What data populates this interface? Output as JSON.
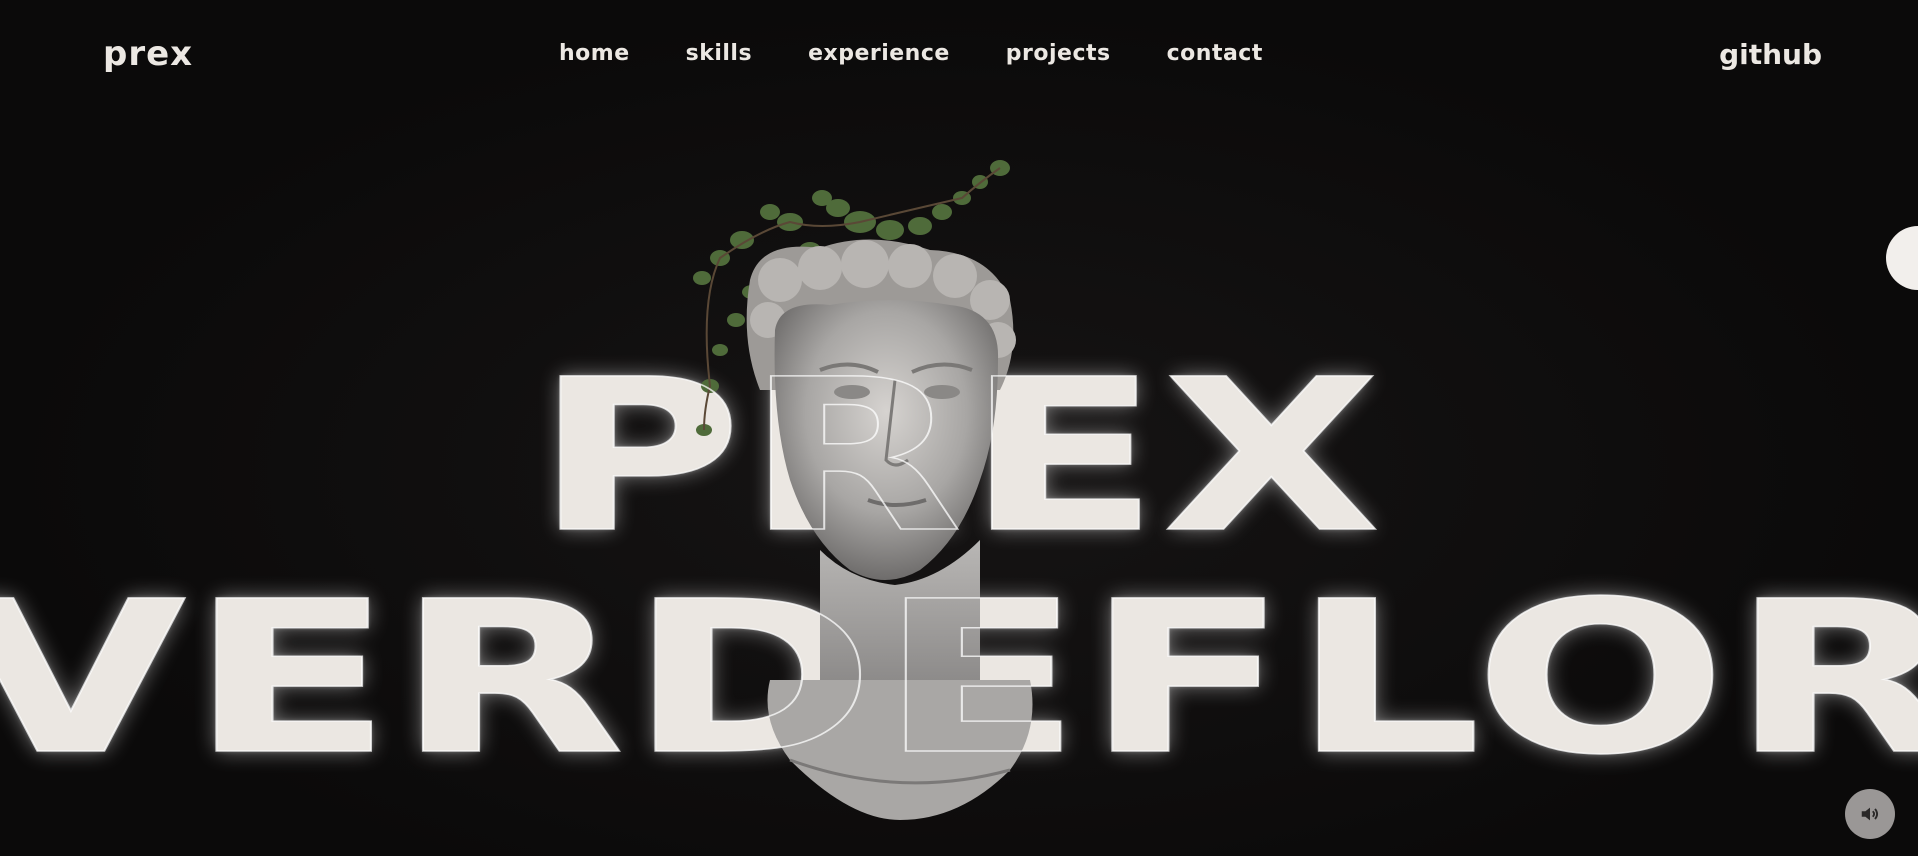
{
  "header": {
    "logo": "prex",
    "nav": [
      {
        "label": "home"
      },
      {
        "label": "skills"
      },
      {
        "label": "experience"
      },
      {
        "label": "projects"
      },
      {
        "label": "contact"
      }
    ],
    "github_label": "github"
  },
  "hero": {
    "first_name": "PREX",
    "last_name": "VERDEFLOR"
  },
  "icons": {
    "sound": "speaker-icon",
    "statue": "statue-planter-image"
  },
  "colors": {
    "background": "#0b0a0a",
    "text": "#ece8e3",
    "sound_button": "#9a9796"
  }
}
